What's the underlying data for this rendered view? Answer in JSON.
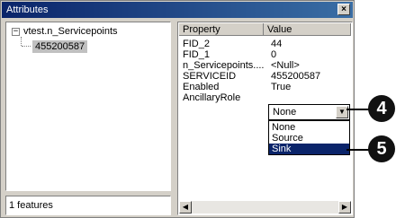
{
  "window": {
    "title": "Attributes",
    "close_glyph": "×"
  },
  "tree": {
    "expander": "−",
    "root_label": "vtest.n_Servicepoints",
    "child_label": "455200587"
  },
  "status": {
    "text": "1 features"
  },
  "grid": {
    "columns": [
      "Property",
      "Value"
    ],
    "rows": [
      {
        "property": "FID_2",
        "value": "44"
      },
      {
        "property": "FID_1",
        "value": "0"
      },
      {
        "property": "n_Servicepoints....",
        "value": "<Null>"
      },
      {
        "property": "SERVICEID",
        "value": "455200587"
      },
      {
        "property": "Enabled",
        "value": "True"
      },
      {
        "property": "AncillaryRole",
        "value": ""
      }
    ],
    "combo": {
      "selected": "None",
      "options": [
        "None",
        "Source",
        "Sink"
      ],
      "highlighted": "Sink"
    }
  },
  "callouts": [
    "4",
    "5"
  ]
}
